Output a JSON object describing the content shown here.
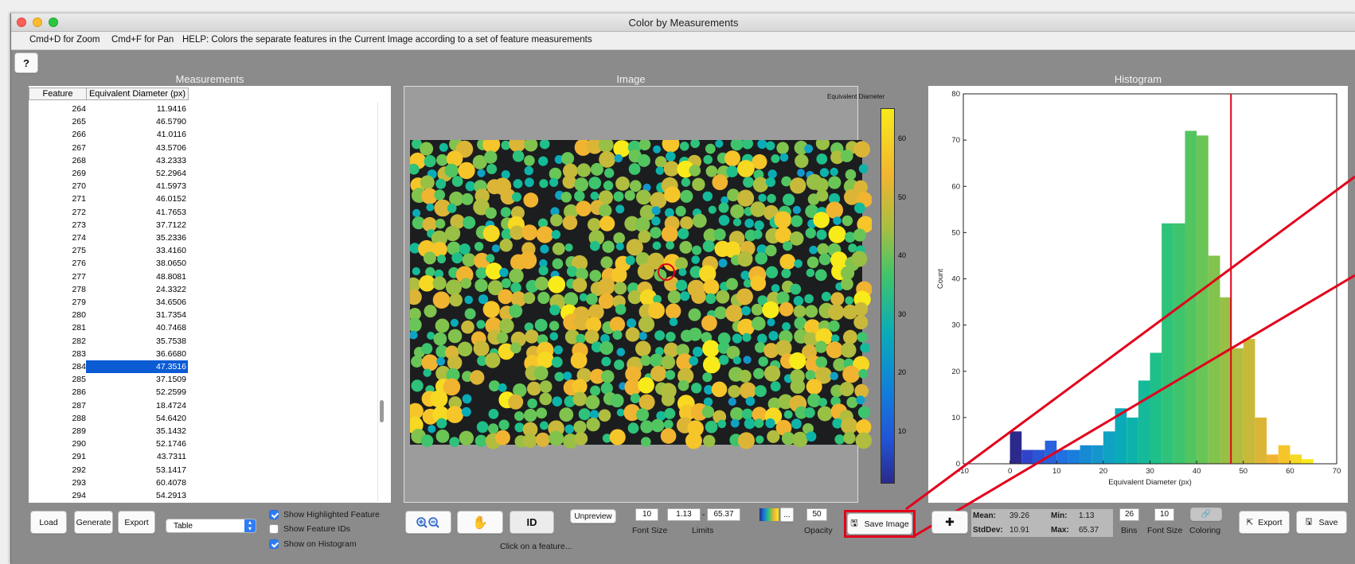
{
  "window": {
    "title": "Color by Measurements"
  },
  "menubar": {
    "zoom_hint": "Cmd+D for Zoom",
    "pan_hint": "Cmd+F for Pan",
    "help_text": "HELP:  Colors the separate features in the Current Image according to a set of feature measurements"
  },
  "help_button": "?",
  "sections": {
    "measurements": "Measurements",
    "image": "Image",
    "histogram": "Histogram"
  },
  "table": {
    "columns": [
      "Feature",
      "Equivalent Diameter (px)"
    ],
    "selected_feature": "284",
    "rows": [
      [
        "264",
        "11.9416"
      ],
      [
        "265",
        "46.5790"
      ],
      [
        "266",
        "41.0116"
      ],
      [
        "267",
        "43.5706"
      ],
      [
        "268",
        "43.2333"
      ],
      [
        "269",
        "52.2964"
      ],
      [
        "270",
        "41.5973"
      ],
      [
        "271",
        "46.0152"
      ],
      [
        "272",
        "41.7653"
      ],
      [
        "273",
        "37.7122"
      ],
      [
        "274",
        "35.2336"
      ],
      [
        "275",
        "33.4160"
      ],
      [
        "276",
        "38.0650"
      ],
      [
        "277",
        "48.8081"
      ],
      [
        "278",
        "24.3322"
      ],
      [
        "279",
        "34.6506"
      ],
      [
        "280",
        "31.7354"
      ],
      [
        "281",
        "40.7468"
      ],
      [
        "282",
        "35.7538"
      ],
      [
        "283",
        "36.6680"
      ],
      [
        "284",
        "47.3516"
      ],
      [
        "285",
        "37.1509"
      ],
      [
        "286",
        "52.2599"
      ],
      [
        "287",
        "18.4724"
      ],
      [
        "288",
        "54.6420"
      ],
      [
        "289",
        "35.1432"
      ],
      [
        "290",
        "52.1746"
      ],
      [
        "291",
        "43.7311"
      ],
      [
        "292",
        "53.1417"
      ],
      [
        "293",
        "60.4078"
      ],
      [
        "294",
        "54.2913"
      ]
    ]
  },
  "colorbar": {
    "title": "Equivalent Diameter (px)",
    "ticks": [
      "60",
      "50",
      "40",
      "30",
      "20",
      "10"
    ]
  },
  "left_controls": {
    "load": "Load",
    "generate": "Generate",
    "export": "Export",
    "view_select": "Table",
    "show_highlighted": {
      "label": "Show Highlighted Feature",
      "checked": true
    },
    "show_ids": {
      "label": "Show Feature IDs",
      "checked": false
    },
    "show_on_histogram": {
      "label": "Show on Histogram",
      "checked": true
    }
  },
  "image_controls": {
    "id_button": "ID",
    "unpreview": "Unpreview",
    "status": "Click on a feature...",
    "font_size": "10",
    "font_size_label": "Font Size",
    "limit_min": "1.13",
    "limit_max": "65.37",
    "limits_label": "Limits",
    "colormap_more": "...",
    "opacity": "50",
    "opacity_label": "Opacity",
    "save_image": "Save Image"
  },
  "hist_controls": {
    "mean_label": "Mean:",
    "mean": "39.26",
    "min_label": "Min:",
    "min": "1.13",
    "stddev_label": "StdDev:",
    "stddev": "10.91",
    "max_label": "Max:",
    "max": "65.37",
    "bins": "26",
    "bins_label": "Bins",
    "font_size": "10",
    "font_size_label": "Font Size",
    "coloring_label": "Coloring",
    "export": "Export",
    "save": "Save"
  },
  "chart_data": {
    "type": "bar",
    "xlabel": "Equivalent Diameter (px)",
    "ylabel": "Count",
    "xlim": [
      -10,
      70
    ],
    "ylim": [
      0,
      80
    ],
    "xticks": [
      -10,
      0,
      10,
      20,
      30,
      40,
      50,
      60,
      70
    ],
    "yticks": [
      0,
      10,
      20,
      30,
      40,
      50,
      60,
      70,
      80
    ],
    "bin_edges": [
      0,
      2.5,
      5,
      7.5,
      10,
      12.5,
      15,
      17.5,
      20,
      22.5,
      25,
      27.5,
      30,
      32.5,
      35,
      37.5,
      40,
      42.5,
      45,
      47.5,
      50,
      52.5,
      55,
      57.5,
      60,
      62.5,
      65
    ],
    "values": [
      7,
      3,
      3,
      5,
      3,
      3,
      4,
      4,
      7,
      12,
      10,
      18,
      24,
      52,
      52,
      72,
      71,
      45,
      36,
      25,
      27,
      10,
      2,
      4,
      2,
      1
    ],
    "highlight_value": 47.3516,
    "colors": [
      "#2b2a8c",
      "#2f45c9",
      "#2a55d6",
      "#2763dd",
      "#1f70e0",
      "#197ddc",
      "#168ad3",
      "#1396cc",
      "#0fa2c4",
      "#0aabb9",
      "#0db3aa",
      "#14ba9a",
      "#1fbf89",
      "#2ec27a",
      "#3dc46c",
      "#52c560",
      "#69c556",
      "#81c34d",
      "#98c045",
      "#b0bd3f",
      "#c8b93a",
      "#ddb536",
      "#f0b431",
      "#f6c52a",
      "#f7d822",
      "#f9ea1a"
    ],
    "highlight_color": "#e3001b"
  }
}
